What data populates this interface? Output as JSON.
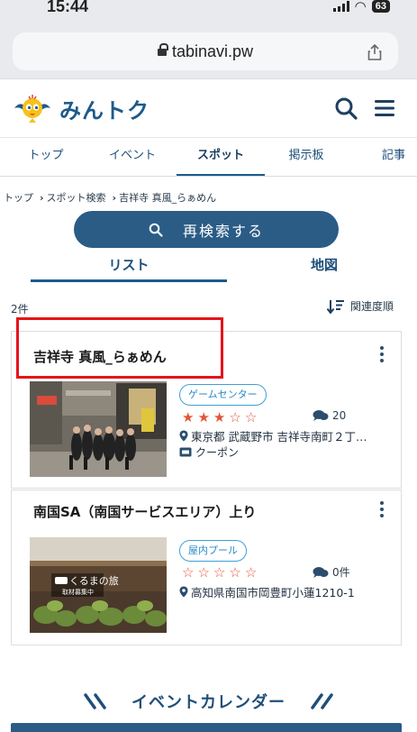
{
  "status_bar": {
    "time": "15:44",
    "battery": "63"
  },
  "browser": {
    "url": "tabinavi.pw"
  },
  "header": {
    "logo_text": "みんトク"
  },
  "nav_tabs": [
    {
      "label": "トップ"
    },
    {
      "label": "イベント"
    },
    {
      "label": "スポット"
    },
    {
      "label": "掲示板"
    },
    {
      "label": "記事"
    }
  ],
  "breadcrumb": {
    "items": [
      "トップ",
      "スポット検索",
      "吉祥寺 真風_らぁめん"
    ]
  },
  "search": {
    "button_label": "再検索する"
  },
  "view_tabs": {
    "list": "リスト",
    "map": "地図"
  },
  "results": {
    "count": "2件",
    "sort_label": "関連度順"
  },
  "spots": [
    {
      "name": "吉祥寺 真風_らぁめん",
      "genre": "ゲームセンター",
      "rating": 3,
      "rating_max": 5,
      "comments": "20",
      "address": "東京都 武蔵野市 吉祥寺南町２丁…",
      "coupon": "クーポン"
    },
    {
      "name": "南国SA（南国サービスエリア）上り",
      "genre": "屋内プール",
      "rating": 0,
      "rating_max": 5,
      "comments": "0件",
      "address": "高知県南国市岡豊町小蓮1210-1",
      "thumb_overlay_title": "くるまの旅",
      "thumb_overlay_sub": "取材募集中"
    }
  ],
  "section": {
    "event_calendar": "イベントカレンダー"
  },
  "colors": {
    "primary": "#2b5c86",
    "accent_red": "#e5533a",
    "tag_blue": "#3da0d8",
    "highlight": "#e5141a"
  }
}
